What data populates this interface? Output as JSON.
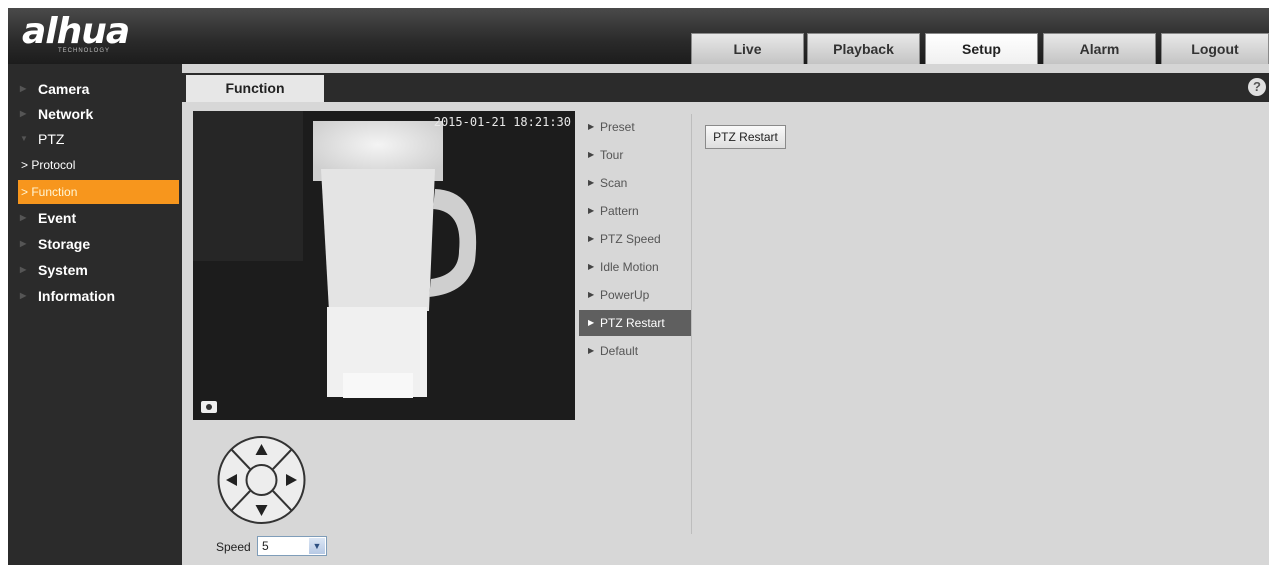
{
  "brand": {
    "logo": "alhua",
    "tagline": "TECHNOLOGY"
  },
  "top_tabs": [
    "Live",
    "Playback",
    "Setup",
    "Alarm",
    "Logout"
  ],
  "active_top_tab": "Setup",
  "sidebar": {
    "items": [
      {
        "label": "Camera"
      },
      {
        "label": "Network"
      },
      {
        "label": "PTZ"
      },
      {
        "label": "> Protocol"
      },
      {
        "label": "> Function"
      },
      {
        "label": "Event"
      },
      {
        "label": "Storage"
      },
      {
        "label": "System"
      },
      {
        "label": "Information"
      }
    ]
  },
  "content_tab": "Function",
  "help_icon": "?",
  "video": {
    "osd_timestamp": "2015-01-21 18:21:30"
  },
  "ptz_menu": [
    "Preset",
    "Tour",
    "Scan",
    "Pattern",
    "PTZ Speed",
    "Idle Motion",
    "PowerUp",
    "PTZ Restart",
    "Default"
  ],
  "ptz_menu_selected": "PTZ Restart",
  "action_button": "PTZ Restart",
  "speed": {
    "label": "Speed",
    "value": "5"
  },
  "colors": {
    "accent": "#f7961d",
    "sidebar": "#2b2b2b",
    "content": "#d7d7d7",
    "menu_selected": "#5f5f5f"
  }
}
